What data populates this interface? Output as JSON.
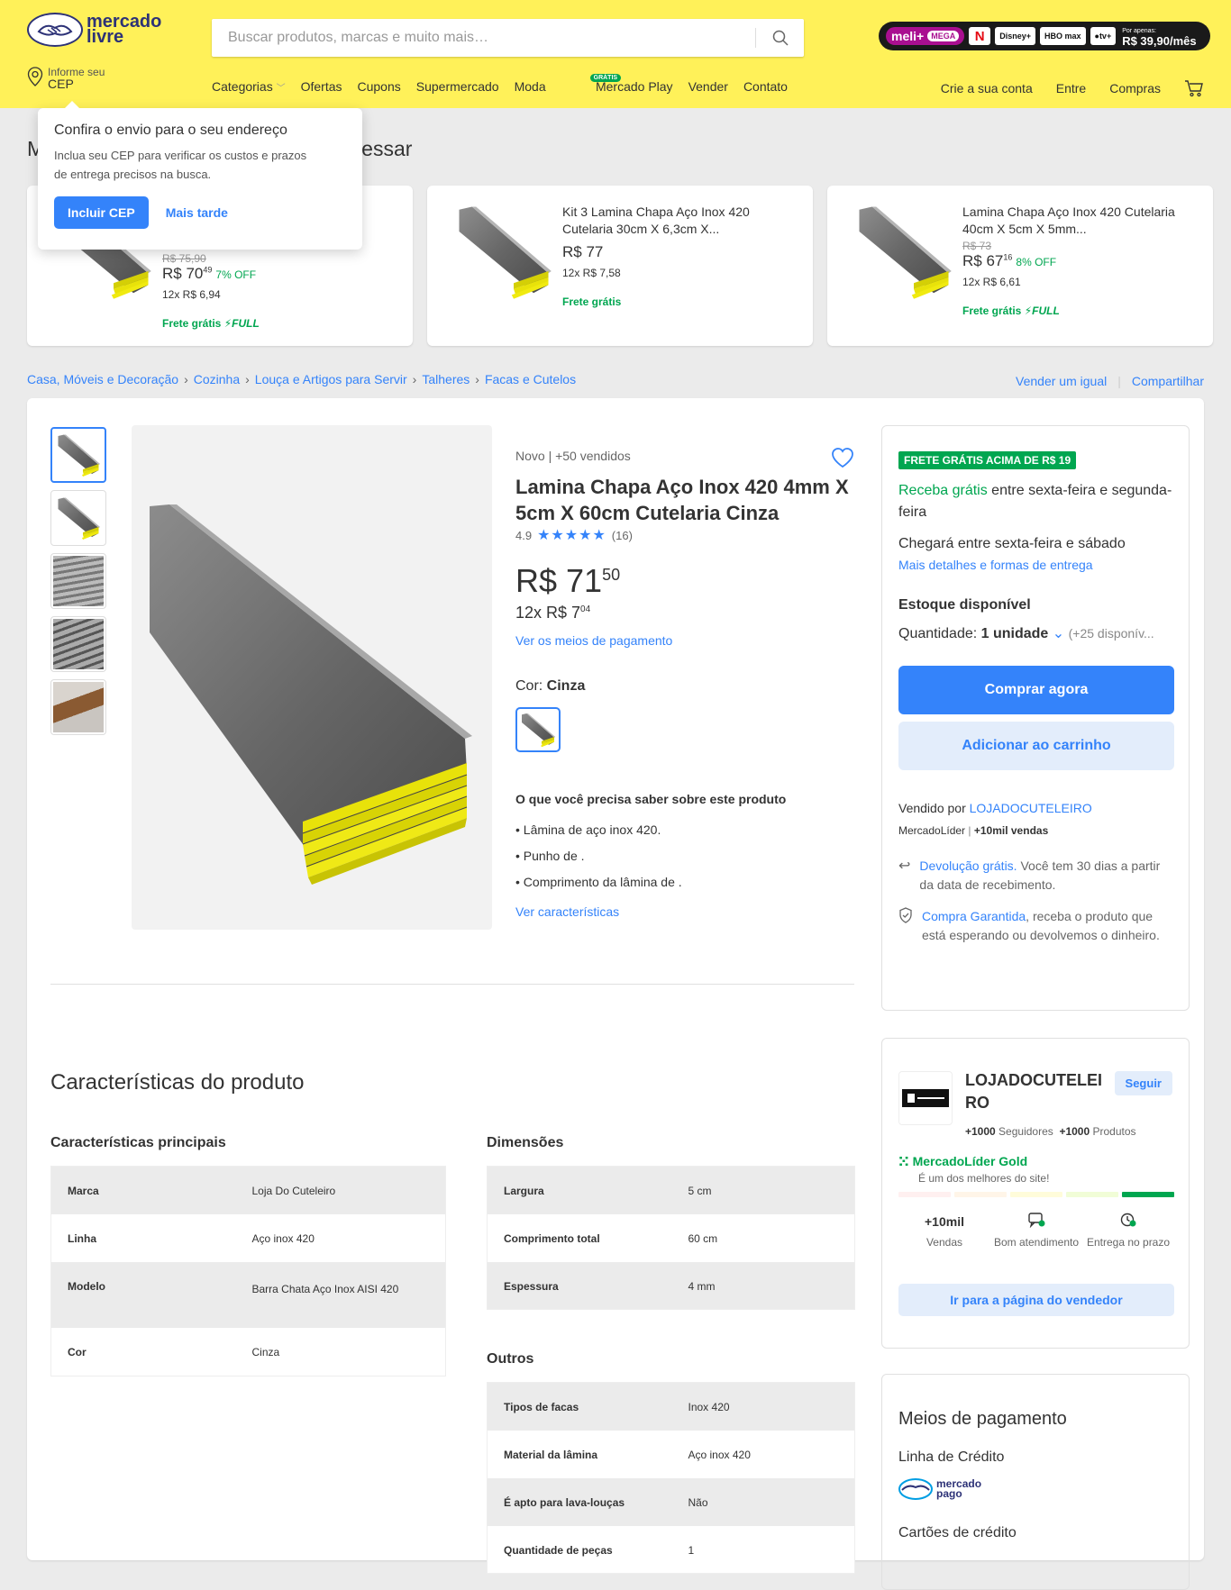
{
  "header": {
    "logo_line1": "mercado",
    "logo_line2": "livre",
    "search_placeholder": "Buscar produtos, marcas e muito mais…",
    "meli": {
      "brand": "meli+",
      "tier": "MEGA",
      "services": [
        "N",
        "Disney+",
        "HBO max",
        "tv+"
      ],
      "price_caption": "Por apenas:",
      "price": "R$ 39,90/mês"
    },
    "cep_small": "Informe seu",
    "cep_big": "CEP",
    "nav": [
      "Categorias",
      "Ofertas",
      "Cupons",
      "Supermercado",
      "Moda",
      "Mercado Play",
      "Vender",
      "Contato"
    ],
    "nav_badge": "GRÁTIS",
    "nav_right": [
      "Crie a sua conta",
      "Entre",
      "Compras"
    ]
  },
  "popup": {
    "title": "Confira o envio para o seu endereço",
    "text": "Inclua seu CEP para verificar os custos e prazos de entrega precisos na busca.",
    "primary": "Incluir CEP",
    "secondary": "Mais tarde"
  },
  "recommendations": {
    "title_visible": "essar",
    "title_prefix": "M",
    "items": [
      {
        "name": "",
        "old_price": "R$ 75,90",
        "price_int": "R$ 70",
        "price_cents": "49",
        "off": "7% OFF",
        "installments": "12x R$ 6,94",
        "shipping": "Frete grátis",
        "full": "FULL"
      },
      {
        "name": "Kit 3 Lamina Chapa Aço Inox 420 Cutelaria 30cm X 6,3cm X...",
        "old_price": "",
        "price_int": "R$ 77",
        "price_cents": "",
        "off": "",
        "installments": "12x R$ 7,58",
        "shipping": "Frete grátis",
        "full": ""
      },
      {
        "name": "Lamina Chapa Aço Inox 420 Cutelaria 40cm X 5cm X 5mm...",
        "old_price": "R$ 73",
        "price_int": "R$ 67",
        "price_cents": "16",
        "off": "8% OFF",
        "installments": "12x R$ 6,61",
        "shipping": "Frete grátis",
        "full": "FULL"
      }
    ]
  },
  "breadcrumb": [
    "Casa, Móveis e Decoração",
    "Cozinha",
    "Louça e Artigos para Servir",
    "Talheres",
    "Facas e Cutelos"
  ],
  "crumb_actions": [
    "Vender um igual",
    "Compartilhar"
  ],
  "product": {
    "condition": "Novo  |  +50 vendidos",
    "title": "Lamina Chapa Aço Inox 420 4mm X 5cm X 60cm Cutelaria Cinza",
    "rating": "4.9",
    "stars": "★★★★★",
    "reviews": "(16)",
    "price_int": "R$ 71",
    "price_cents": "50",
    "installments_int": "12x R$ 7",
    "installments_cents": "04",
    "payment_link": "Ver os meios de pagamento",
    "color_label": "Cor: ",
    "color_value": "Cinza",
    "know_title": "O que você precisa saber sobre este produto",
    "bullets": [
      "Lâmina de aço inox 420.",
      "Punho de .",
      "Comprimento da lâmina de ."
    ],
    "characteristics_link": "Ver características"
  },
  "buybox": {
    "badge": "FRETE GRÁTIS ACIMA DE R$ 19",
    "ship_green": "Receba grátis",
    "ship_rest": " entre sexta-feira e segunda-feira",
    "ship2": "Chegará entre sexta-feira e sábado",
    "ship_link": "Mais detalhes e formas de entrega",
    "stock": "Estoque disponível",
    "qty_label": "Quantidade: ",
    "qty_value": "1 unidade",
    "qty_avail": "(+25 disponív...",
    "buy": "Comprar agora",
    "cart": "Adicionar ao carrinho",
    "sold_by": "Vendido por ",
    "seller": "LOJADOCUTELEIRO",
    "leader": "MercadoLíder",
    "sales": "+10mil vendas",
    "return_link": "Devolução grátis.",
    "return_text": " Você tem 30 dias a partir da data de recebimento.",
    "guarantee_link": "Compra Garantida",
    "guarantee_text": ", receba o produto que está esperando ou devolvemos o dinheiro."
  },
  "seller_card": {
    "name": "LOJADOCUTELEIRO",
    "follow": "Seguir",
    "followers_count": "+1000",
    "followers_label": "Seguidores",
    "products_count": "+1000",
    "products_label": "Produtos",
    "leader": "MercadoLíder Gold",
    "leader_sub": "É um dos melhores do site!",
    "metrics": [
      {
        "value": "+10mil",
        "label": "Vendas"
      },
      {
        "value": "",
        "label": "Bom atendimento"
      },
      {
        "value": "",
        "label": "Entrega no prazo"
      }
    ],
    "button": "Ir para a página do vendedor",
    "thermometer_colors": [
      "#fff0f0",
      "#fff5e8",
      "#fffcda",
      "#f1fdd7",
      "#00a650"
    ]
  },
  "payments": {
    "title": "Meios de pagamento",
    "credit_line": "Linha de Crédito",
    "mp_line1": "mercado",
    "mp_line2": "pago",
    "cards": "Cartões de crédito"
  },
  "characteristics": {
    "title": "Características do produto",
    "main_title": "Características principais",
    "main": [
      {
        "k": "Marca",
        "v": "Loja Do Cuteleiro"
      },
      {
        "k": "Linha",
        "v": "Aço inox 420"
      },
      {
        "k": "Modelo",
        "v": "Barra Chata Aço Inox AISI 420"
      },
      {
        "k": "Cor",
        "v": "Cinza"
      }
    ],
    "dims_title": "Dimensões",
    "dims": [
      {
        "k": "Largura",
        "v": "5 cm"
      },
      {
        "k": "Comprimento total",
        "v": "60 cm"
      },
      {
        "k": "Espessura",
        "v": "4 mm"
      }
    ],
    "others_title": "Outros",
    "others": [
      {
        "k": "Tipos de facas",
        "v": "Inox 420"
      },
      {
        "k": "Material da lâmina",
        "v": "Aço inox 420"
      },
      {
        "k": "É apto para lava-louças",
        "v": "Não"
      },
      {
        "k": "Quantidade de peças",
        "v": "1"
      }
    ]
  },
  "colors": {
    "header_yellow": "#fff159",
    "accent_blue": "#3483fa",
    "green": "#00a650",
    "steel_yellow_edge": "#e8e20a"
  }
}
